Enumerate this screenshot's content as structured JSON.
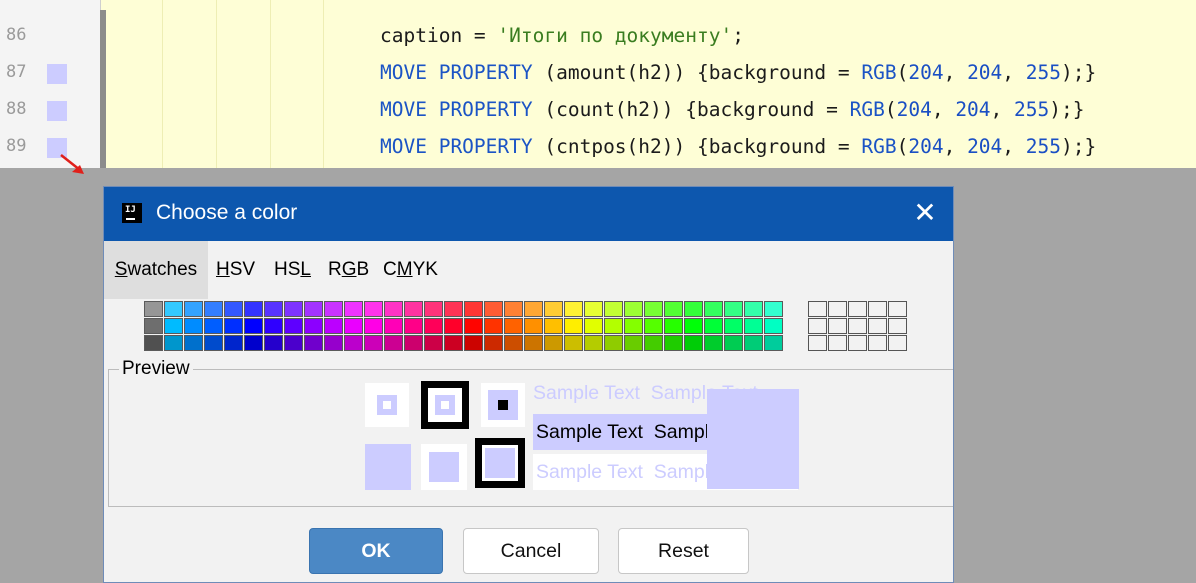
{
  "editor": {
    "line_numbers": [
      "86",
      "87",
      "88",
      "89"
    ],
    "line86": {
      "prefix": "caption = ",
      "str": "'Итоги по документу'",
      "suffix": ";"
    },
    "line87": {
      "kw": "MOVE PROPERTY",
      "mid": " (amount(h2)) {background = ",
      "fn": "RGB",
      "open": "(",
      "r": "204",
      "sep1": ", ",
      "g": "204",
      "sep2": ", ",
      "b": "255",
      "close": ");}"
    },
    "line88": {
      "kw": "MOVE PROPERTY",
      "mid": " (count(h2)) {background = ",
      "fn": "RGB",
      "open": "(",
      "r": "204",
      "sep1": ", ",
      "g": "204",
      "sep2": ", ",
      "b": "255",
      "close": ");}"
    },
    "line89": {
      "kw": "MOVE PROPERTY",
      "mid": " (cntpos(h2)) {background = ",
      "fn": "RGB",
      "open": "(",
      "r": "204",
      "sep1": ", ",
      "g": "204",
      "sep2": ", ",
      "b": "255",
      "close": ");}"
    },
    "swatch_color": "#ccccff"
  },
  "dialog": {
    "title": "Choose a color",
    "app_icon_glyph": "IJ",
    "close_glyph": "✕",
    "tabs": {
      "swatches": {
        "pre": "",
        "mn": "S",
        "post": "watches"
      },
      "hsv": {
        "pre": "",
        "mn": "H",
        "post": "SV"
      },
      "hsl": {
        "pre": "HS",
        "mn": "L",
        "post": ""
      },
      "rgb": {
        "pre": "R",
        "mn": "G",
        "post": "B"
      },
      "cmyk": {
        "pre": "C",
        "mn": "M",
        "post": "YK"
      }
    },
    "active_tab": "Swatches",
    "preview_label": "Preview",
    "sample_text": "Sample Text",
    "selected_color": "#ccccff",
    "buttons": {
      "ok": "OK",
      "cancel": "Cancel",
      "reset": "Reset"
    }
  }
}
